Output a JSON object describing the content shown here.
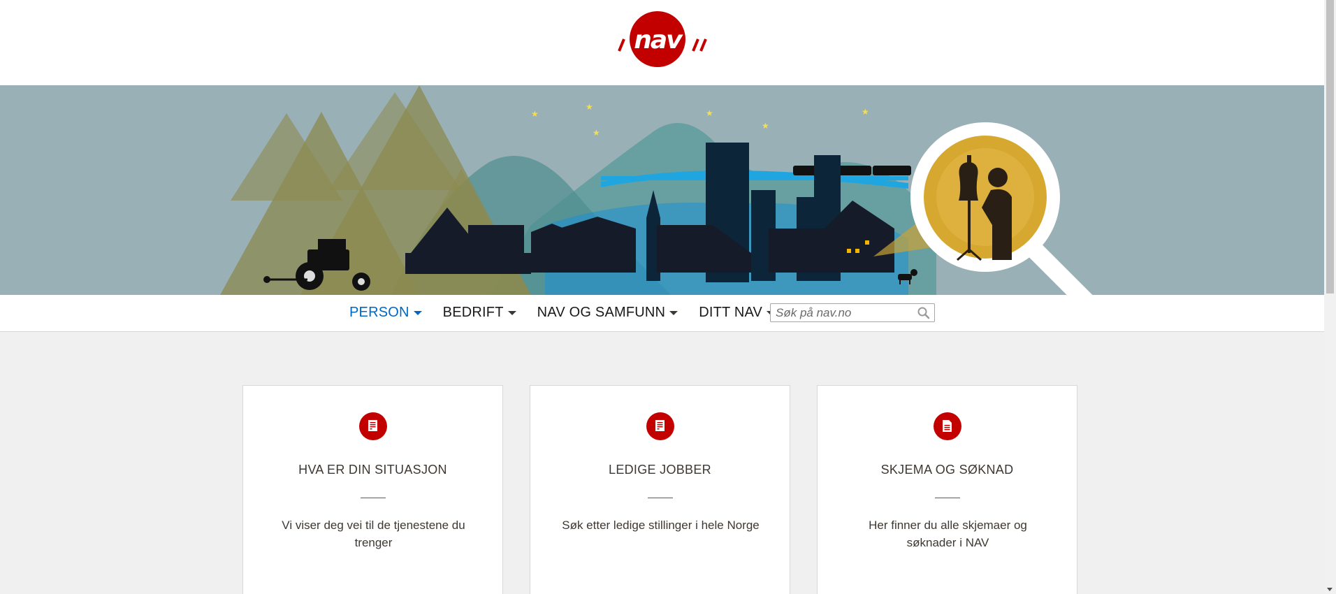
{
  "header": {
    "logo_text": "nav"
  },
  "nav": {
    "items": [
      {
        "label": "PERSON",
        "active": true
      },
      {
        "label": "BEDRIFT",
        "active": false
      },
      {
        "label": "NAV OG SAMFUNN",
        "active": false
      },
      {
        "label": "DITT NAV",
        "active": false
      }
    ],
    "search_placeholder": "Søk på nav.no"
  },
  "cards": [
    {
      "icon": "document-icon",
      "title": "HVA ER DIN SITUASJON",
      "description": "Vi viser deg vei til de tjenestene du trenger"
    },
    {
      "icon": "document-icon",
      "title": "LEDIGE JOBBER",
      "description": "Søk etter ledige stillinger i hele Norge"
    },
    {
      "icon": "form-icon",
      "title": "SKJEMA OG SØKNAD",
      "description": "Her finner du alle skjemaer og søknader i NAV"
    }
  ],
  "colors": {
    "brand_red": "#c30000",
    "link_blue": "#0067c5",
    "hero_sky": "#99b0b6",
    "page_bg": "#f0f0f0"
  }
}
